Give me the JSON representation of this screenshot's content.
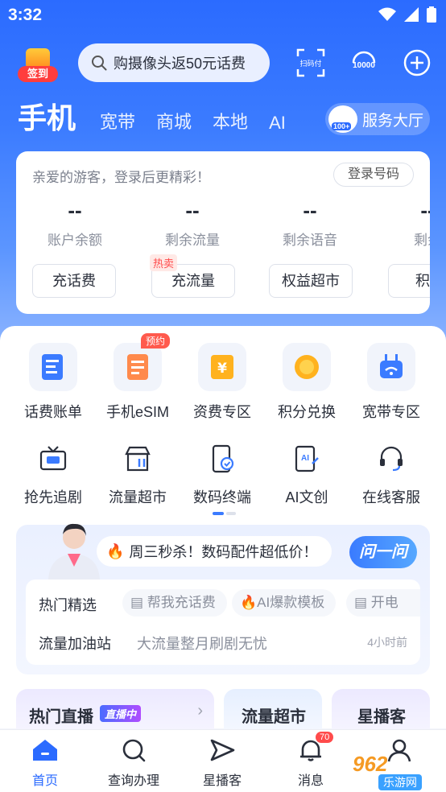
{
  "status": {
    "time": "3:32"
  },
  "header": {
    "checkin_label": "签到",
    "search_placeholder": "购摄像头返50元话费",
    "scan_label": "扫码付",
    "hotline_label": "10000"
  },
  "tabs": [
    "手机",
    "宽带",
    "商城",
    "本地",
    "AI"
  ],
  "hall": {
    "label": "服务大厅",
    "badge": "100+"
  },
  "account": {
    "greeting": "亲爱的游客，登录后更精彩！",
    "login_label": "登录号码",
    "stats": [
      {
        "value": "--",
        "label": "账户余额"
      },
      {
        "value": "--",
        "label": "剩余流量"
      },
      {
        "value": "--",
        "label": "剩余语音"
      },
      {
        "value": "--",
        "label": "剩余"
      }
    ],
    "buttons": [
      "充话费",
      "充流量",
      "权益超市",
      "积分"
    ],
    "hot_tag": "热卖"
  },
  "grid": {
    "row1": [
      {
        "label": "话费账单",
        "icon": "bill-icon"
      },
      {
        "label": "手机eSIM",
        "icon": "esim-icon",
        "tag": "预约"
      },
      {
        "label": "资费专区",
        "icon": "tariff-icon"
      },
      {
        "label": "积分兑换",
        "icon": "points-icon"
      },
      {
        "label": "宽带专区",
        "icon": "router-icon"
      }
    ],
    "row2": [
      {
        "label": "抢先追剧",
        "icon": "tv-icon"
      },
      {
        "label": "流量超市",
        "icon": "store-icon"
      },
      {
        "label": "数码终端",
        "icon": "phone-icon"
      },
      {
        "label": "AI文创",
        "icon": "ai-doc-icon"
      },
      {
        "label": "在线客服",
        "icon": "headset-icon"
      }
    ]
  },
  "promo": {
    "banner": "周三秒杀！数码配件超低价！",
    "ask_label": "问一问",
    "row1_title": "热门精选",
    "chips": [
      "帮我充话费",
      "AI爆款模板",
      "开电"
    ],
    "row2_title": "流量加油站",
    "row2_text": "大流量整月刷剧无忧",
    "row2_time": "4小时前"
  },
  "sections": {
    "live": "热门直播",
    "live_badge": "直播中",
    "flow": "流量超市",
    "star": "星播客"
  },
  "nav": [
    {
      "label": "首页"
    },
    {
      "label": "查询办理"
    },
    {
      "label": "星播客"
    },
    {
      "label": "消息",
      "badge": "70"
    },
    {
      "label": "我的"
    }
  ],
  "watermark": {
    "number": "962",
    "site": "乐游网"
  },
  "colors": {
    "brand": "#2b6bff",
    "hot": "#ff4b4b"
  }
}
